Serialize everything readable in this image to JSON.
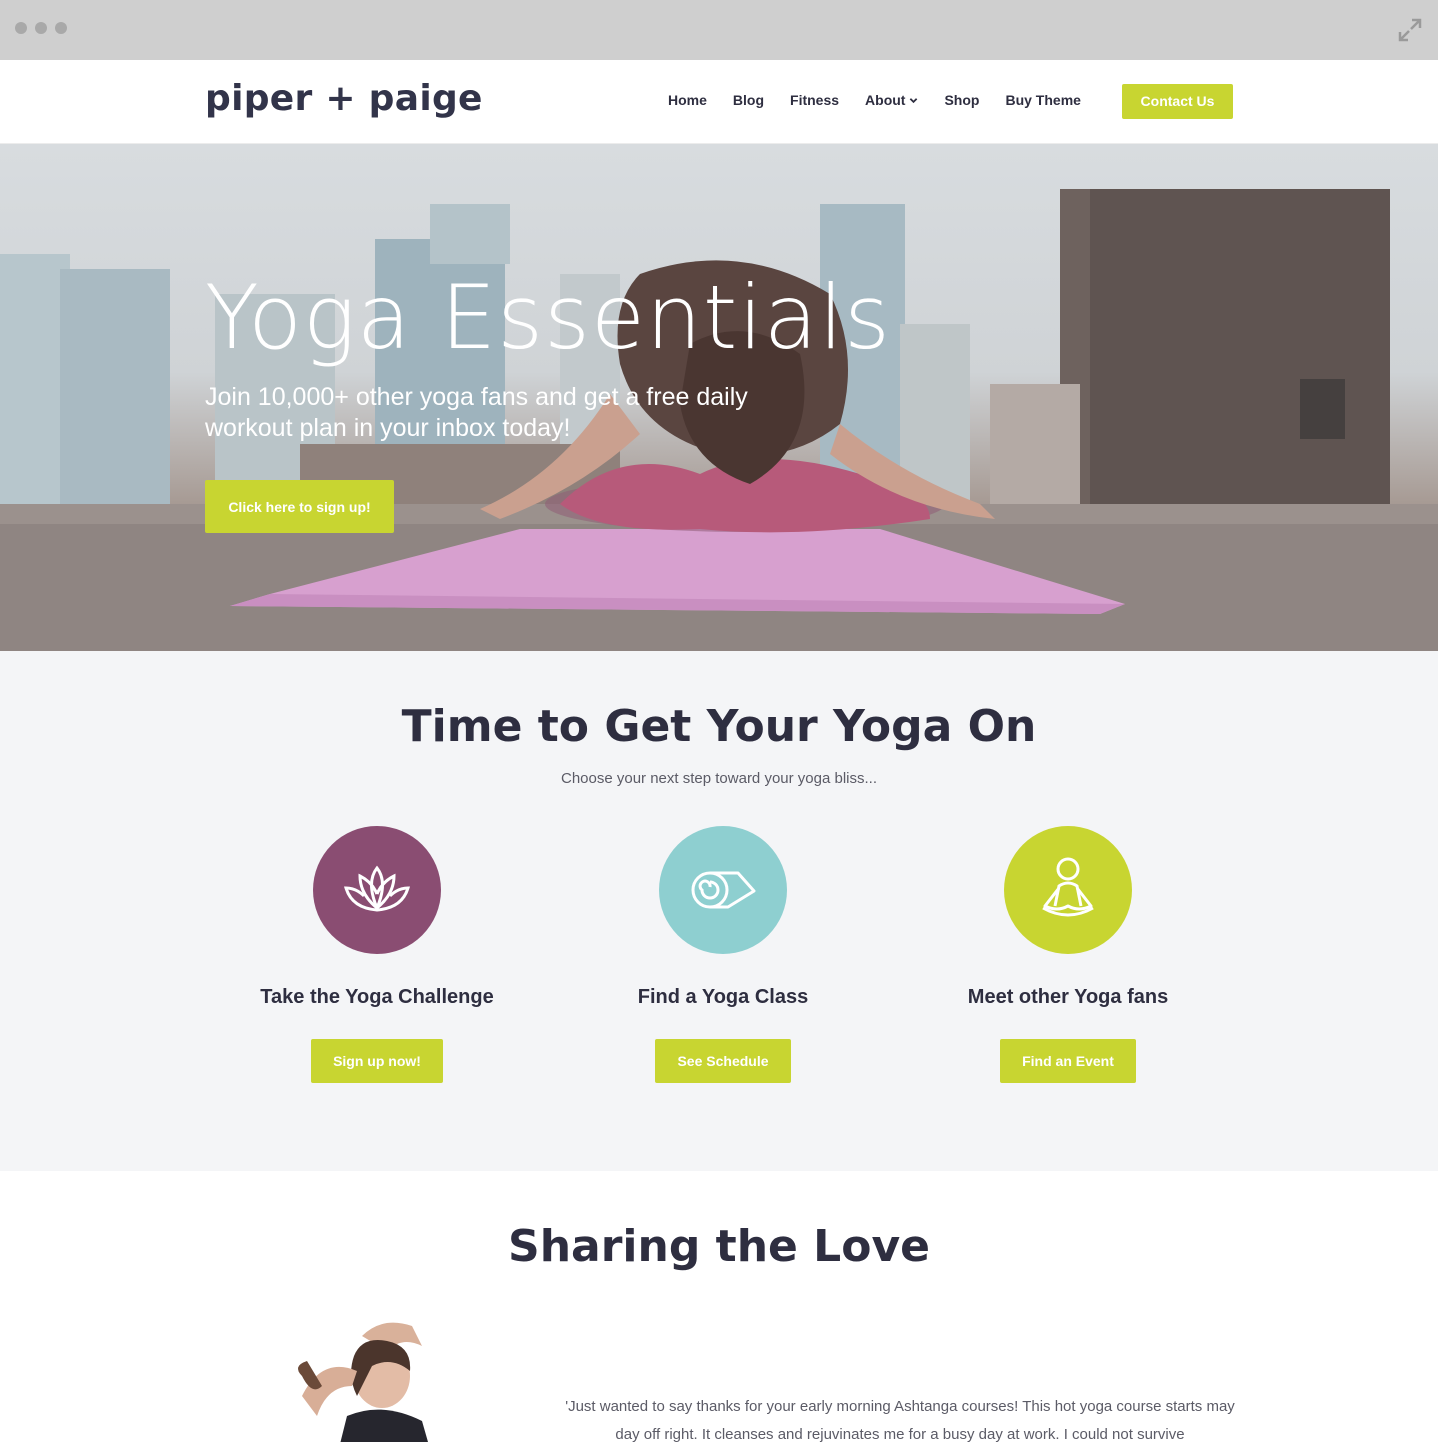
{
  "colors": {
    "accent": "#c8d531",
    "plum": "#8a4d72",
    "aqua": "#8ecfd0",
    "lime": "#c8d531",
    "dark_text": "#2e2e40"
  },
  "header": {
    "logo": "piper + paige",
    "nav": [
      {
        "label": "Home"
      },
      {
        "label": "Blog"
      },
      {
        "label": "Fitness"
      },
      {
        "label": "About"
      },
      {
        "label": "Shop"
      },
      {
        "label": "Buy Theme"
      }
    ],
    "contact_label": "Contact Us"
  },
  "hero": {
    "title": "Yoga Essentials",
    "subtitle": "Join 10,000+ other yoga fans and get a free daily workout plan in your inbox today!",
    "button_label": "Click here to sign up!"
  },
  "features": {
    "title": "Time to Get Your Yoga On",
    "subtitle": "Choose your next step toward your yoga bliss...",
    "cards": [
      {
        "icon": "lotus-icon",
        "title": "Take the Yoga Challenge",
        "button": "Sign up now!"
      },
      {
        "icon": "yoga-mat-icon",
        "title": "Find a Yoga Class",
        "button": "See Schedule"
      },
      {
        "icon": "meditation-icon",
        "title": "Meet other Yoga fans",
        "button": "Find an Event"
      }
    ]
  },
  "testimonials": {
    "title": "Sharing the Love",
    "quote": "'Just wanted to say thanks for your early morning Ashtanga courses! This hot yoga course starts may day off right. It cleanses and rejuvinates me for a busy day at work. I could not survive"
  }
}
